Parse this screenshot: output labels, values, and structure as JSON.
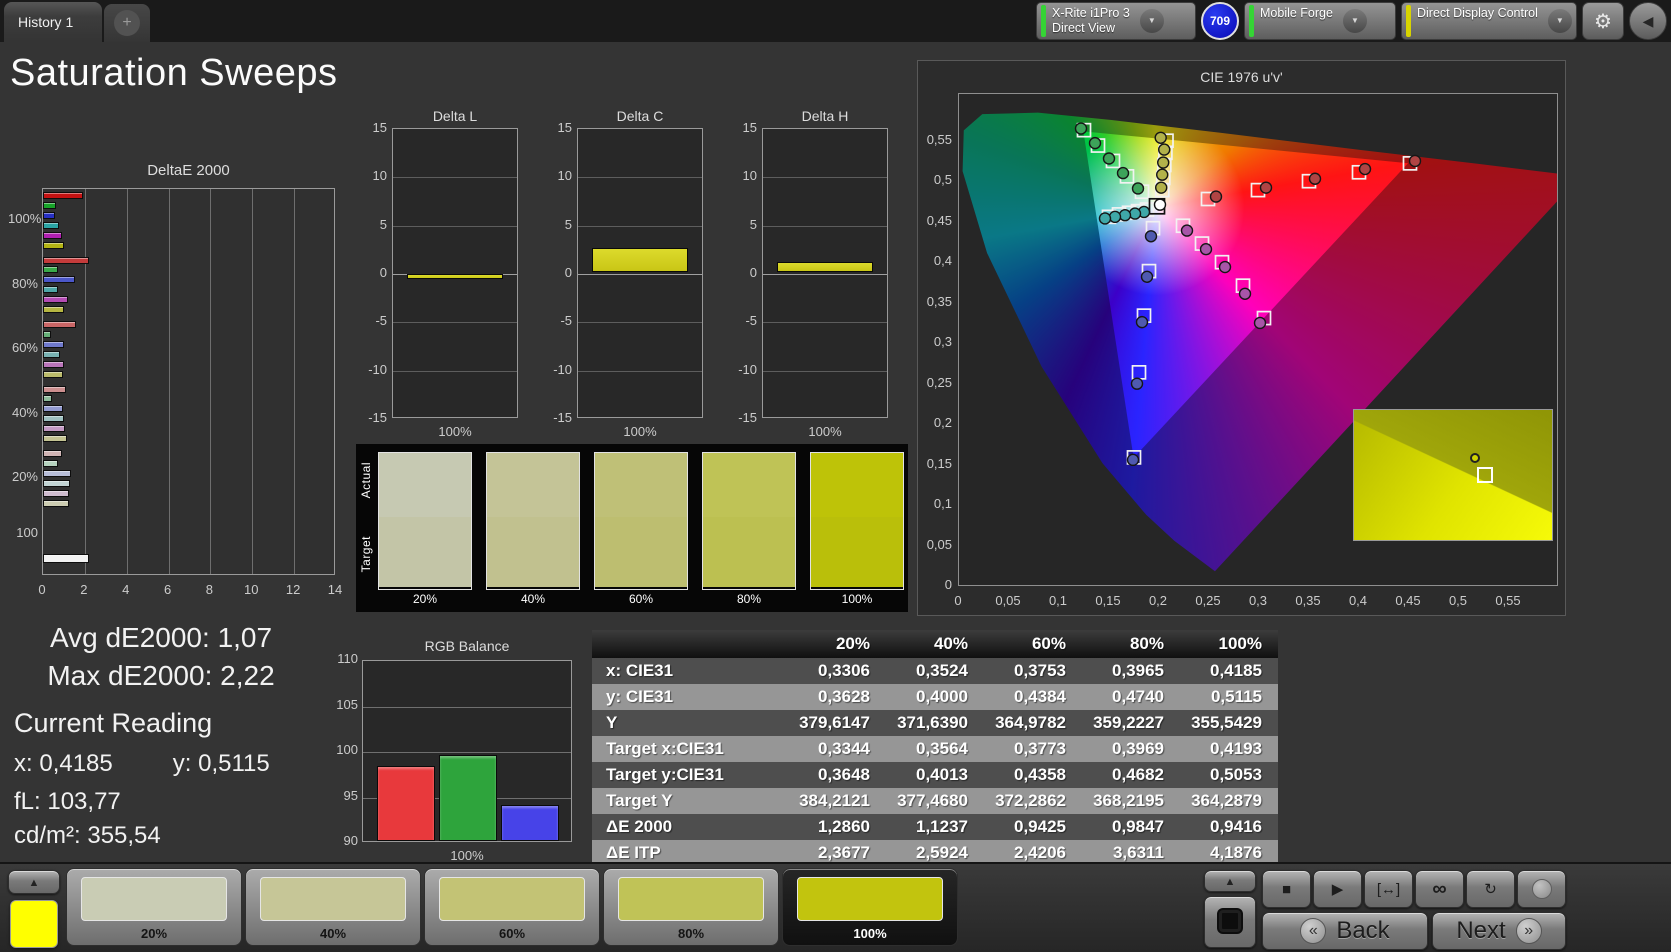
{
  "window": {
    "tab_label": "History 1",
    "add_tab_label": "+"
  },
  "toolbar": {
    "meter_line1": "X-Rite i1Pro 3",
    "meter_line2": "Direct View",
    "meter_stripe": "#35d435",
    "badge_label": "709",
    "pattern_source_label": "Mobile Forge",
    "pattern_stripe": "#35d435",
    "display_control_label": "Direct Display Control",
    "display_stripe": "#d8d400",
    "gear_icon": "⚙",
    "collapse_icon": "◀",
    "chevron": "▼"
  },
  "page_title": "Saturation Sweeps",
  "stats": {
    "avg_label": "Avg dE2000:",
    "avg_value": "1,07",
    "max_label": "Max dE2000:",
    "max_value": "2,22",
    "current_reading_label": "Current Reading",
    "x_label": "x:",
    "x_value": "0,4185",
    "y_label": "y:",
    "y_value": "0,5115",
    "fl_label": "fL:",
    "fl_value": "103,77",
    "cdm2_label": "cd/m²:",
    "cdm2_value": "355,54"
  },
  "chart_data": {
    "deltae2000": {
      "type": "bar",
      "title": "DeltaE 2000",
      "xlim": [
        0,
        14
      ],
      "xticks": [
        0,
        2,
        4,
        6,
        8,
        10,
        12,
        14
      ],
      "series_names": [
        "Red",
        "Green",
        "Blue",
        "Cyan",
        "Magenta",
        "Yellow"
      ],
      "groups": [
        {
          "label": "100%",
          "values": [
            1.9,
            0.6,
            0.55,
            0.75,
            0.9,
            1.0
          ],
          "colors": [
            "#c41212",
            "#17a329",
            "#2730c4",
            "#2aa4a4",
            "#b01fb0",
            "#b4b414"
          ]
        },
        {
          "label": "80%",
          "values": [
            2.2,
            0.7,
            1.55,
            0.7,
            1.2,
            1.0
          ],
          "colors": [
            "#c43b3b",
            "#3aaa4a",
            "#4b57c9",
            "#4fa8a8",
            "#b44cb4",
            "#b6b642"
          ]
        },
        {
          "label": "60%",
          "values": [
            1.6,
            0.4,
            1.0,
            0.8,
            1.0,
            0.95
          ],
          "colors": [
            "#c96666",
            "#66b078",
            "#6f79cc",
            "#79b2b2",
            "#ba75ba",
            "#bbbb6b"
          ]
        },
        {
          "label": "40%",
          "values": [
            1.1,
            0.45,
            0.95,
            1.0,
            1.05,
            1.15
          ],
          "colors": [
            "#cc8f8f",
            "#8fbd9c",
            "#939bd1",
            "#9fc1c1",
            "#c49ac4",
            "#c3c392"
          ]
        },
        {
          "label": "20%",
          "values": [
            0.9,
            0.7,
            1.35,
            1.3,
            1.25,
            1.25
          ],
          "colors": [
            "#d0b4b4",
            "#b6d3bf",
            "#b7bdd8",
            "#c2d4d4",
            "#cfbccf",
            "#cdcdb2"
          ]
        },
        {
          "label": "100",
          "values": [
            2.2
          ],
          "colors": [
            "#f2f2f2"
          ]
        }
      ]
    },
    "delta_l": {
      "type": "bar",
      "title": "Delta L",
      "ylim": [
        -15,
        15
      ],
      "yticks": [
        15,
        10,
        5,
        0,
        -5,
        -10,
        -15
      ],
      "category": "100%",
      "value": -0.5,
      "bar_color": "#c9c616"
    },
    "delta_c": {
      "type": "bar",
      "title": "Delta C",
      "ylim": [
        -15,
        15
      ],
      "yticks": [
        15,
        10,
        5,
        0,
        -5,
        -10,
        -15
      ],
      "category": "100%",
      "value": 2.5,
      "bar_color": "#c9c616"
    },
    "delta_h": {
      "type": "bar",
      "title": "Delta H",
      "ylim": [
        -15,
        15
      ],
      "yticks": [
        15,
        10,
        5,
        0,
        -5,
        -10,
        -15
      ],
      "category": "100%",
      "value": 1.0,
      "bar_color": "#c9c616"
    },
    "cie": {
      "type": "scatter",
      "title": "CIE 1976 u'v'",
      "xlim": [
        0,
        0.6
      ],
      "ylim": [
        0,
        0.6086
      ],
      "xtick_values": [
        0,
        0.05,
        0.1,
        0.15,
        0.2,
        0.25,
        0.3,
        0.35,
        0.4,
        0.45,
        0.5,
        0.55
      ],
      "xtick_labels": [
        "0",
        "0,05",
        "0,1",
        "0,15",
        "0,2",
        "0,25",
        "0,3",
        "0,35",
        "0,4",
        "0,45",
        "0,5",
        "0,55"
      ],
      "ytick_values": [
        0,
        0.05,
        0.1,
        0.15,
        0.2,
        0.25,
        0.3,
        0.35,
        0.4,
        0.45,
        0.5,
        0.55
      ],
      "ytick_labels": [
        "0",
        "0,05",
        "0,1",
        "0,15",
        "0,2",
        "0,25",
        "0,3",
        "0,35",
        "0,4",
        "0,45",
        "0,5",
        "0,55"
      ],
      "white_target": [
        0.198,
        0.47
      ],
      "white_measured": [
        0.201,
        0.472
      ],
      "series": [
        {
          "name": "red",
          "marker_color": "#b04444",
          "targets": [
            [
              0.249,
              0.479
            ],
            [
              0.299,
              0.49
            ],
            [
              0.35,
              0.501
            ],
            [
              0.4,
              0.512
            ],
            [
              0.451,
              0.523
            ]
          ],
          "measured": [
            [
              0.257,
              0.482
            ],
            [
              0.307,
              0.493
            ],
            [
              0.356,
              0.504
            ],
            [
              0.406,
              0.516
            ],
            [
              0.456,
              0.526
            ]
          ]
        },
        {
          "name": "green",
          "marker_color": "#3da35a",
          "targets": [
            [
              0.183,
              0.488
            ],
            [
              0.168,
              0.507
            ],
            [
              0.154,
              0.526
            ],
            [
              0.139,
              0.545
            ],
            [
              0.125,
              0.564
            ]
          ],
          "measured": [
            [
              0.179,
              0.492
            ],
            [
              0.164,
              0.511
            ],
            [
              0.15,
              0.529
            ],
            [
              0.136,
              0.548
            ],
            [
              0.122,
              0.566
            ]
          ]
        },
        {
          "name": "blue",
          "marker_color": "#4f5ab0",
          "targets": [
            [
              0.194,
              0.443
            ],
            [
              0.19,
              0.39
            ],
            [
              0.185,
              0.335
            ],
            [
              0.18,
              0.265
            ],
            [
              0.175,
              0.16
            ]
          ],
          "measured": [
            [
              0.192,
              0.433
            ],
            [
              0.188,
              0.383
            ],
            [
              0.183,
              0.327
            ],
            [
              0.178,
              0.251
            ],
            [
              0.174,
              0.157
            ]
          ]
        },
        {
          "name": "cyan",
          "marker_color": "#3fa8a8",
          "targets": [
            [
              0.188,
              0.466
            ],
            [
              0.179,
              0.464
            ],
            [
              0.17,
              0.462
            ],
            [
              0.16,
              0.46
            ],
            [
              0.15,
              0.457
            ]
          ],
          "measured": [
            [
              0.185,
              0.463
            ],
            [
              0.176,
              0.461
            ],
            [
              0.166,
              0.459
            ],
            [
              0.156,
              0.457
            ],
            [
              0.146,
              0.455
            ]
          ]
        },
        {
          "name": "magenta",
          "marker_color": "#a855a8",
          "targets": [
            [
              0.224,
              0.446
            ],
            [
              0.243,
              0.424
            ],
            [
              0.263,
              0.401
            ],
            [
              0.284,
              0.372
            ],
            [
              0.305,
              0.332
            ]
          ],
          "measured": [
            [
              0.228,
              0.44
            ],
            [
              0.247,
              0.417
            ],
            [
              0.266,
              0.395
            ],
            [
              0.286,
              0.362
            ],
            [
              0.301,
              0.326
            ]
          ]
        },
        {
          "name": "yellow",
          "marker_color": "#b2b24a",
          "targets": [
            [
              0.2033,
              0.49
            ],
            [
              0.2043,
              0.505
            ],
            [
              0.2053,
              0.521
            ],
            [
              0.2064,
              0.536
            ],
            [
              0.2075,
              0.551
            ]
          ],
          "measured": [
            [
              0.2022,
              0.493
            ],
            [
              0.2032,
              0.509
            ],
            [
              0.2042,
              0.524
            ],
            [
              0.2052,
              0.54
            ],
            [
              0.2017,
              0.5546
            ]
          ]
        }
      ],
      "inset": {
        "target": [
          66,
          50
        ],
        "measured": [
          61,
          37
        ]
      }
    },
    "rgb_balance": {
      "type": "bar",
      "title": "RGB Balance",
      "categories": [
        "Red",
        "Green",
        "Blue"
      ],
      "values": [
        98.2,
        99.4,
        94.0
      ],
      "colors": [
        "#e8393c",
        "#2ea43c",
        "#4743e8"
      ],
      "ylim": [
        90,
        110
      ],
      "yticks": [
        90,
        95,
        100,
        105,
        110
      ],
      "xlabel": "100%"
    },
    "sweep_table": {
      "type": "table",
      "columns": [
        "",
        "20%",
        "40%",
        "60%",
        "80%",
        "100%"
      ],
      "rows": [
        {
          "label": "x: CIE31",
          "values": [
            "0,3306",
            "0,3524",
            "0,3753",
            "0,3965",
            "0,4185"
          ]
        },
        {
          "label": "y: CIE31",
          "values": [
            "0,3628",
            "0,4000",
            "0,4384",
            "0,4740",
            "0,5115"
          ]
        },
        {
          "label": "Y",
          "values": [
            "379,6147",
            "371,6390",
            "364,9782",
            "359,2227",
            "355,5429"
          ]
        },
        {
          "label": "Target x:CIE31",
          "values": [
            "0,3344",
            "0,3564",
            "0,3773",
            "0,3969",
            "0,4193"
          ]
        },
        {
          "label": "Target y:CIE31",
          "values": [
            "0,3648",
            "0,4013",
            "0,4358",
            "0,4682",
            "0,5053"
          ]
        },
        {
          "label": "Target Y",
          "values": [
            "384,2121",
            "377,4680",
            "372,2862",
            "368,2195",
            "364,2879"
          ]
        },
        {
          "label": "ΔE 2000",
          "values": [
            "1,2860",
            "1,1237",
            "0,9425",
            "0,9847",
            "0,9416"
          ]
        },
        {
          "label": "ΔE ITP",
          "values": [
            "2,3677",
            "2,5924",
            "2,4206",
            "3,6311",
            "4,1876"
          ]
        }
      ]
    }
  },
  "swatch_strip": {
    "row_labels": [
      "Actual",
      "Target"
    ],
    "patches": [
      {
        "label": "20%",
        "actual": "#c6c9b2",
        "target": "#c3c5a7"
      },
      {
        "label": "40%",
        "actual": "#c4c497",
        "target": "#c1c18f"
      },
      {
        "label": "60%",
        "actual": "#bfc077",
        "target": "#bdbe70"
      },
      {
        "label": "80%",
        "actual": "#bfc356",
        "target": "#bcc051"
      },
      {
        "label": "100%",
        "actual": "#bec308",
        "target": "#babf0a"
      }
    ]
  },
  "bottom_bar": {
    "current_color": "#ffff00",
    "up_arrow": "▲",
    "patches": [
      {
        "label": "20%",
        "color": "#c9ccb4",
        "selected": false
      },
      {
        "label": "40%",
        "color": "#c6c697",
        "selected": false
      },
      {
        "label": "60%",
        "color": "#c3c375",
        "selected": false
      },
      {
        "label": "80%",
        "color": "#c0c357",
        "selected": false
      },
      {
        "label": "100%",
        "color": "#c2c40e",
        "selected": true
      }
    ],
    "transport": [
      {
        "name": "stop-icon",
        "glyph": "■"
      },
      {
        "name": "play-icon",
        "glyph": "▶"
      },
      {
        "name": "range-icon",
        "glyph": "[↔]"
      },
      {
        "name": "infinity-icon",
        "glyph": "∞"
      },
      {
        "name": "loop-icon",
        "glyph": "↻"
      },
      {
        "name": "indicator-icon",
        "glyph": ""
      }
    ],
    "back_icon": "«",
    "back_label": "Back",
    "next_label": "Next",
    "next_icon": "»"
  }
}
